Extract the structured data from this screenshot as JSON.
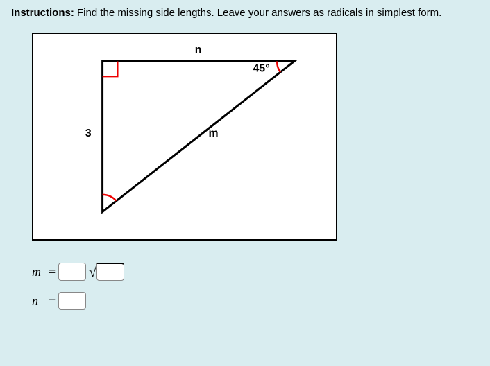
{
  "instructions": {
    "label": "Instructions:",
    "text": " Find the missing side lengths. Leave your answers as radicals in simplest form."
  },
  "figure": {
    "label_n": "n",
    "label_m": "m",
    "label_3": "3",
    "angle_45": "45°"
  },
  "answers": {
    "m_var": "m",
    "n_var": "n",
    "eq": "=",
    "m_coef_value": "",
    "m_rad_value": "",
    "n_value": ""
  },
  "chart_data": {
    "type": "diagram",
    "shape": "right_triangle",
    "right_angle_at": "top_left",
    "given_angle": {
      "vertex": "top_right",
      "degrees": 45
    },
    "sides": {
      "vertical_left": {
        "label": "3",
        "length": 3
      },
      "horizontal_top": {
        "label": "n",
        "length": null
      },
      "hypotenuse": {
        "label": "m",
        "length": null
      }
    },
    "unknowns": [
      "m",
      "n"
    ],
    "answer_format": {
      "m": "coefficient * sqrt(radicand)",
      "n": "integer"
    }
  }
}
